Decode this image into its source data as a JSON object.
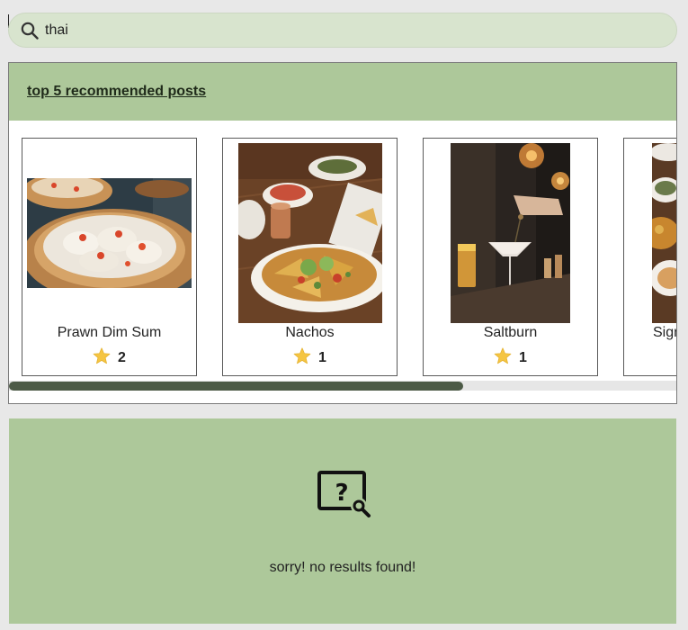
{
  "search": {
    "value": "thai",
    "icon": "search-icon"
  },
  "recommended": {
    "title": "top 5 recommended posts",
    "cards": [
      {
        "name": "Prawn Dim Sum",
        "rating": "2",
        "image": "dim-sum-photo"
      },
      {
        "name": "Nachos",
        "rating": "1",
        "image": "nachos-photo"
      },
      {
        "name": "Saltburn",
        "rating": "1",
        "image": "cocktail-photo"
      },
      {
        "name": "Signature",
        "rating": "",
        "image": "dish-photo"
      }
    ],
    "scroll_fraction": 0.68
  },
  "no_results": {
    "icon": "question-search-icon",
    "message": "sorry! no results found!"
  },
  "colors": {
    "background": "#e8e8e8",
    "search_bg": "#d8e4ce",
    "panel_green": "#adc89a",
    "scroll_thumb": "#4c5a46",
    "star": "#f5c542"
  }
}
